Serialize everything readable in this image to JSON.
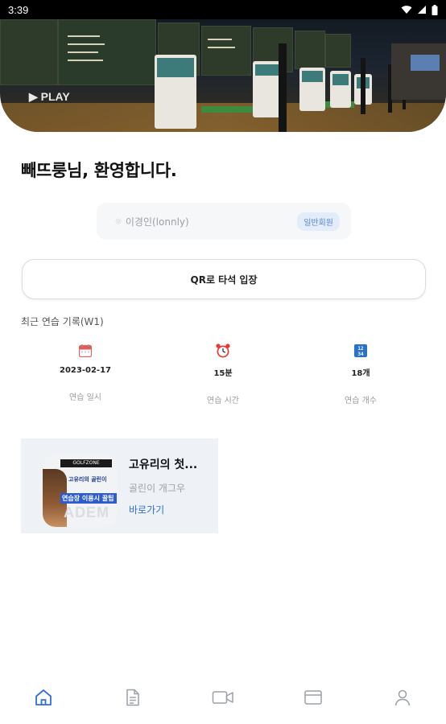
{
  "status_bar": {
    "time": "3:39",
    "icons": [
      "wifi-icon",
      "signal-icon",
      "battery-icon"
    ]
  },
  "hero": {
    "play_text": "▶ PLAY"
  },
  "welcome": "빼뜨룽님, 환영합니다.",
  "member": {
    "name": "이경인(lonnly)",
    "badge": "일반회원"
  },
  "qr_button": "QR로 타석 입장",
  "practice": {
    "title": "최근 연습 기록(W1)",
    "stats": [
      {
        "icon": "calendar-icon",
        "value": "2023-02-17",
        "label": "연습 일시"
      },
      {
        "icon": "alarm-clock-icon",
        "value": "15분",
        "label": "연습 시간"
      },
      {
        "icon": "counter-icon",
        "value": "18개",
        "label": "연습 개수"
      }
    ]
  },
  "promo": {
    "title": "고유리의 첫...",
    "subtitle": "골린이 개그우",
    "link": "바로가기",
    "thumb_texts": [
      "GOLFZONE",
      "고유리의 골린이",
      "연습장 이용시 꿀팁",
      "ADEM"
    ]
  },
  "bottom_nav": [
    "home-icon",
    "document-icon",
    "video-icon",
    "card-icon",
    "profile-icon"
  ],
  "colors": {
    "accent": "#2e6fd9",
    "badge_bg": "#e2ecfb",
    "badge_text": "#5a86cf"
  }
}
